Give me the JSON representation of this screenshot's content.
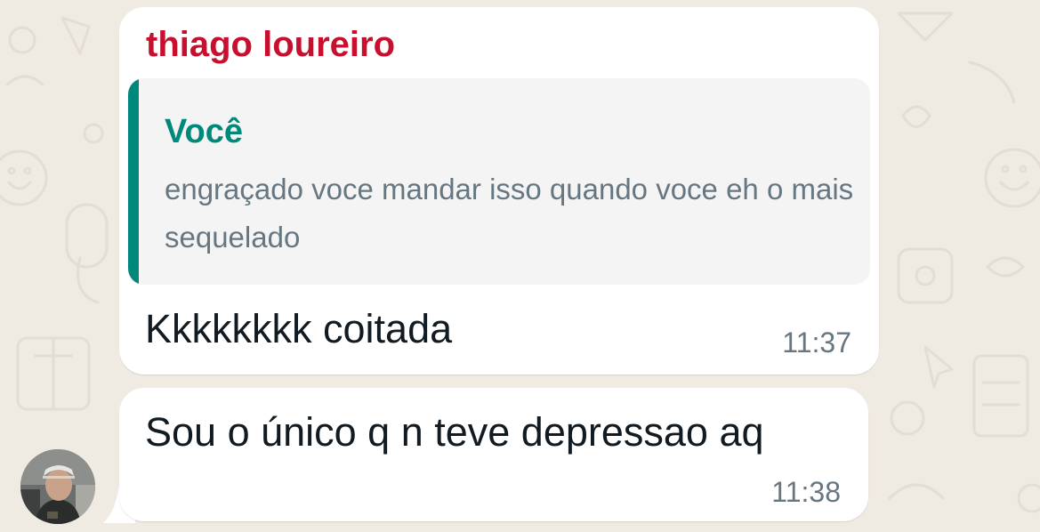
{
  "chat": {
    "background_color": "#efeae2",
    "accent_sender_color": "#c8102e",
    "accent_quote_color": "#00897b"
  },
  "messages": [
    {
      "sender": "thiago loureiro",
      "quoted": {
        "author": "Você",
        "text": "engraçado voce mandar isso quando voce eh o mais sequelado"
      },
      "text": "Kkkkkkkk coitada",
      "time": "11:37"
    },
    {
      "text": "Sou o único q n teve depressao aq",
      "time": "11:38",
      "avatar_icon": "profile-photo"
    }
  ]
}
